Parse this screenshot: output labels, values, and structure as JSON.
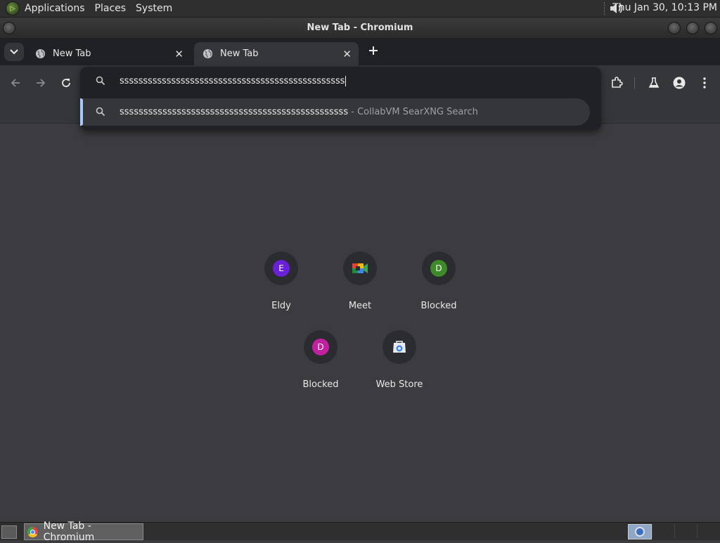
{
  "top_panel": {
    "menus": [
      "Applications",
      "Places",
      "System"
    ],
    "clock": "Thu Jan 30, 10:13 PM"
  },
  "window": {
    "title": "New Tab - Chromium"
  },
  "tabs": [
    {
      "label": "New Tab"
    },
    {
      "label": "New Tab"
    }
  ],
  "omnibox": {
    "input_value": "ssssssssssssssssssssssssssssssssssssssssssssssss",
    "suggestion": {
      "text": "ssssssssssssssssssssssssssssssssssssssssssssssss",
      "engine": " - CollabVM SearXNG Search"
    }
  },
  "shortcuts": [
    {
      "letter": "E",
      "label": "Eldy",
      "color": "#6a1fd8"
    },
    {
      "letter": "",
      "label": "Meet",
      "color": ""
    },
    {
      "letter": "D",
      "label": "Blocked",
      "color": "#3e8a2a"
    },
    {
      "letter": "D",
      "label": "Blocked",
      "color": "#c2209f"
    },
    {
      "letter": "",
      "label": "Web Store",
      "color": ""
    }
  ],
  "taskbar": {
    "task_label": "New Tab - Chromium"
  },
  "colors": {
    "accent": "#a8c7fa",
    "page_bg": "#3c3c40",
    "toolbar_bg": "#35363a",
    "tabstrip_bg": "#202124"
  }
}
